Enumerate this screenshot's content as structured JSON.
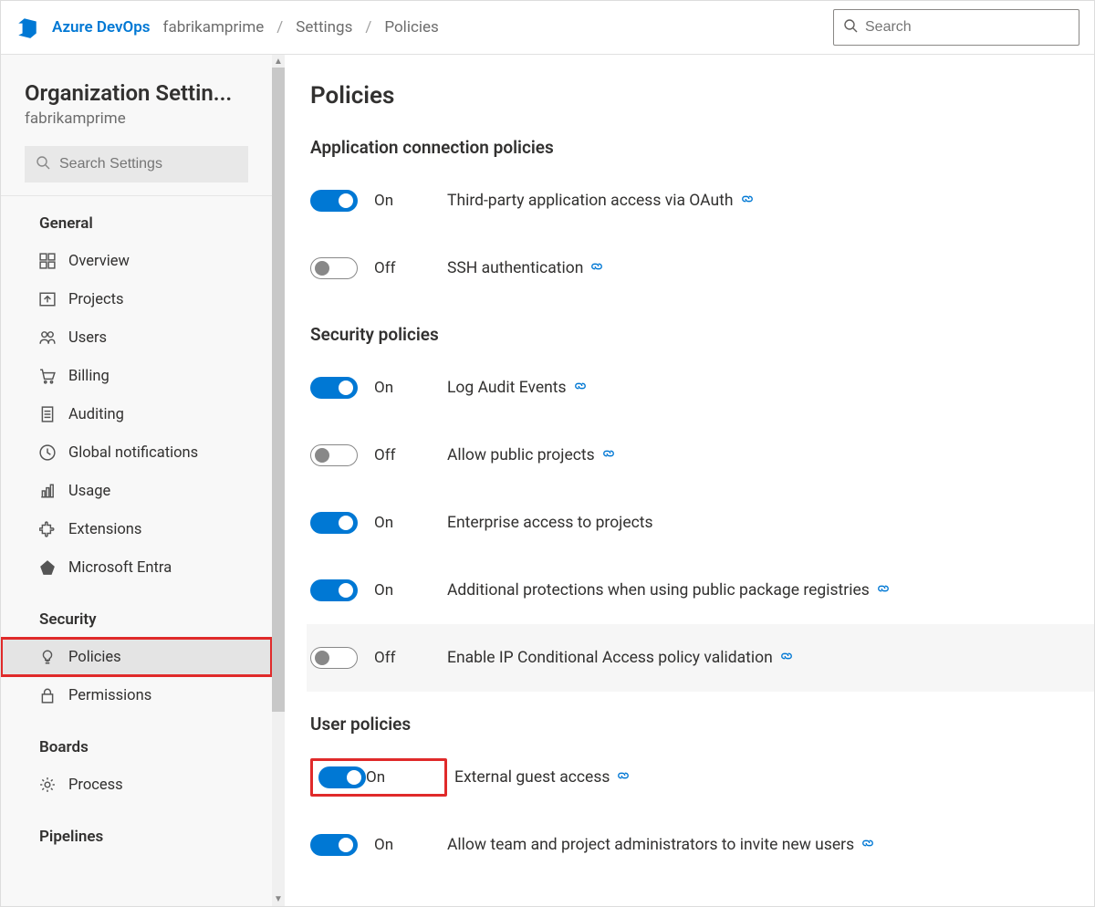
{
  "header": {
    "product": "Azure DevOps",
    "org": "fabrikamprime",
    "breadcrumb": [
      "Settings",
      "Policies"
    ],
    "searchPlaceholder": "Search"
  },
  "sidebar": {
    "title": "Organization Settin...",
    "org": "fabrikamprime",
    "searchPlaceholder": "Search Settings",
    "sections": [
      {
        "header": "General",
        "items": [
          {
            "label": "Overview",
            "icon": "grid"
          },
          {
            "label": "Projects",
            "icon": "upload"
          },
          {
            "label": "Users",
            "icon": "users"
          },
          {
            "label": "Billing",
            "icon": "cart"
          },
          {
            "label": "Auditing",
            "icon": "doc"
          },
          {
            "label": "Global notifications",
            "icon": "clock"
          },
          {
            "label": "Usage",
            "icon": "chart"
          },
          {
            "label": "Extensions",
            "icon": "puzzle"
          },
          {
            "label": "Microsoft Entra",
            "icon": "entra"
          }
        ]
      },
      {
        "header": "Security",
        "items": [
          {
            "label": "Policies",
            "icon": "bulb",
            "active": true,
            "highlight": true
          },
          {
            "label": "Permissions",
            "icon": "lock"
          }
        ]
      },
      {
        "header": "Boards",
        "items": [
          {
            "label": "Process",
            "icon": "gear"
          }
        ]
      },
      {
        "header": "Pipelines",
        "items": []
      }
    ]
  },
  "main": {
    "title": "Policies",
    "groups": [
      {
        "title": "Application connection policies",
        "policies": [
          {
            "label": "Third-party application access via OAuth",
            "state": "On",
            "on": true,
            "link": true
          },
          {
            "label": "SSH authentication",
            "state": "Off",
            "on": false,
            "link": true
          }
        ]
      },
      {
        "title": "Security policies",
        "policies": [
          {
            "label": "Log Audit Events",
            "state": "On",
            "on": true,
            "link": true
          },
          {
            "label": "Allow public projects",
            "state": "Off",
            "on": false,
            "link": true
          },
          {
            "label": "Enterprise access to projects",
            "state": "On",
            "on": true,
            "link": false
          },
          {
            "label": "Additional protections when using public package registries",
            "state": "On",
            "on": true,
            "link": true
          },
          {
            "label": "Enable IP Conditional Access policy validation",
            "state": "Off",
            "on": false,
            "link": true,
            "shaded": true
          }
        ]
      },
      {
        "title": "User policies",
        "policies": [
          {
            "label": "External guest access",
            "state": "On",
            "on": true,
            "link": true,
            "highlightToggle": true
          },
          {
            "label": "Allow team and project administrators to invite new users",
            "state": "On",
            "on": true,
            "link": true
          }
        ]
      }
    ]
  },
  "colors": {
    "accent": "#0078d4",
    "highlight": "#e02a2a"
  }
}
